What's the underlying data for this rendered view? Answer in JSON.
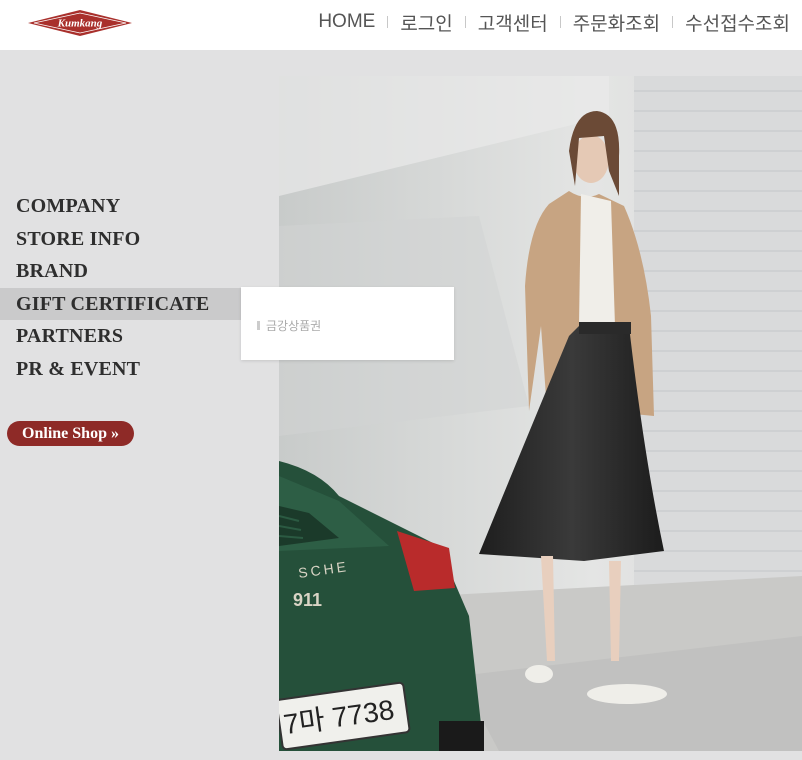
{
  "header": {
    "logo_text": "Kumkang",
    "nav": [
      "HOME",
      "로그인",
      "고객센터",
      "주문화조회",
      "수선접수조회"
    ]
  },
  "sidebar": {
    "items": [
      "COMPANY",
      "STORE INFO",
      "BRAND",
      "GIFT CERTIFICATE",
      "PARTNERS",
      "PR & EVENT"
    ],
    "active_index": 3,
    "online_shop": "Online Shop »"
  },
  "submenu": {
    "item": "금강상품권"
  },
  "hero": {
    "car_badge": "SCHE",
    "car_model": "911",
    "plate": "7마 7738"
  },
  "colors": {
    "brand": "#8e2a27",
    "background": "#e1e1e2"
  }
}
